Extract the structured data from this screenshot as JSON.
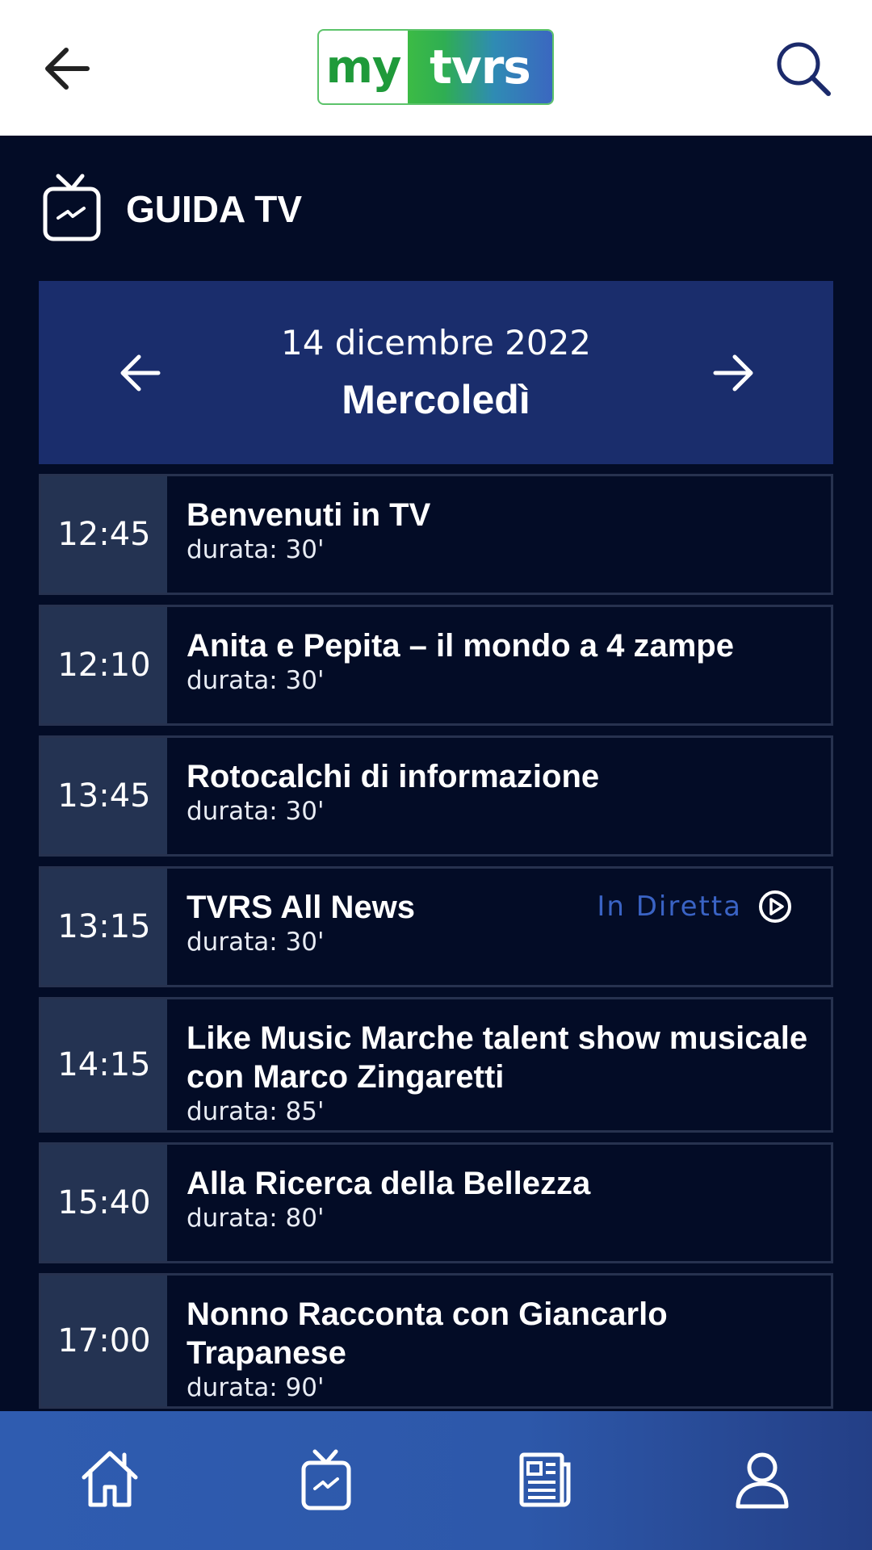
{
  "header": {
    "logo_left": "my",
    "logo_right": "tvrs",
    "logo_colors": {
      "green": "#3cbb45",
      "blue": "#3b67c0"
    }
  },
  "section": {
    "title": "GUIDA TV",
    "icon": "tv-guide-icon"
  },
  "date_selector": {
    "date": "14 dicembre 2022",
    "day": "Mercoledì"
  },
  "schedule": [
    {
      "time": "12:45",
      "title": "Benvenuti in TV",
      "duration": "durata: 30'"
    },
    {
      "time": "12:10",
      "title": "Anita e Pepita – il mondo a 4 zampe",
      "duration": "durata: 30'"
    },
    {
      "time": "13:45",
      "title": "Rotocalchi di informazione",
      "duration": "durata: 30'"
    },
    {
      "time": "13:15",
      "title": "TVRS All News",
      "duration": "durata: 30'",
      "live_label": "In Diretta"
    },
    {
      "time": "14:15",
      "title": "Like Music Marche talent show musicale con Marco Zingaretti",
      "duration": "durata: 85'"
    },
    {
      "time": "15:40",
      "title": "Alla Ricerca della Bellezza",
      "duration": "durata: 80'"
    },
    {
      "time": "17:00",
      "title": "Nonno Racconta con Giancarlo Trapanese",
      "duration": "durata: 90'"
    }
  ],
  "bottom_nav": [
    "home-icon",
    "tv-guide-icon",
    "news-icon",
    "profile-icon"
  ],
  "colors": {
    "background": "#030c26",
    "date_bar": "#1a2d6c",
    "time_cell": "#243352",
    "live_text": "#3a63c4",
    "nav": "#2f5cb0"
  }
}
